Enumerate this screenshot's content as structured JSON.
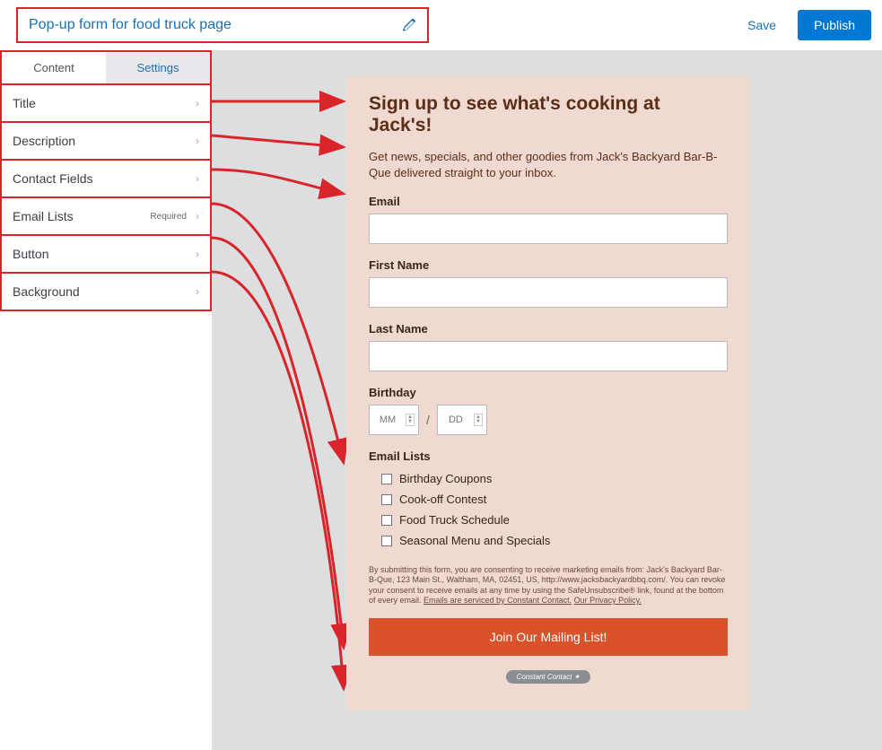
{
  "header": {
    "title": "Pop-up form for food truck page",
    "save": "Save",
    "publish": "Publish"
  },
  "tabs": {
    "content": "Content",
    "settings": "Settings"
  },
  "sidebar": {
    "items": [
      {
        "label": "Title",
        "required": ""
      },
      {
        "label": "Description",
        "required": ""
      },
      {
        "label": "Contact Fields",
        "required": ""
      },
      {
        "label": "Email Lists",
        "required": "Required"
      },
      {
        "label": "Button",
        "required": ""
      },
      {
        "label": "Background",
        "required": ""
      }
    ]
  },
  "form": {
    "title": "Sign up to see what's cooking at Jack's!",
    "description": "Get news, specials, and other goodies from Jack's Backyard Bar-B-Que delivered straight to your inbox.",
    "email_label": "Email",
    "first_name_label": "First Name",
    "last_name_label": "Last Name",
    "birthday_label": "Birthday",
    "mm_placeholder": "MM",
    "dd_placeholder": "DD",
    "slash": "/",
    "lists_label": "Email Lists",
    "lists": [
      "Birthday Coupons",
      "Cook-off Contest",
      "Food Truck Schedule",
      "Seasonal Menu and Specials"
    ],
    "disclaimer_pre": "By submitting this form, you are consenting to receive marketing emails from: Jack's Backyard Bar-B-Que, 123 Main St., Waltham, MA, 02451, US, http://www.jacksbackyardbbq.com/. You can revoke your consent to receive emails at any time by using the SafeUnsubscribe® link, found at the bottom of every email. ",
    "disclaimer_link": "Emails are serviced by Constant Contact.",
    "disclaimer_link2": "Our Privacy Policy.",
    "cta": "Join Our Mailing List!",
    "badge": "Constant Contact ✦"
  }
}
